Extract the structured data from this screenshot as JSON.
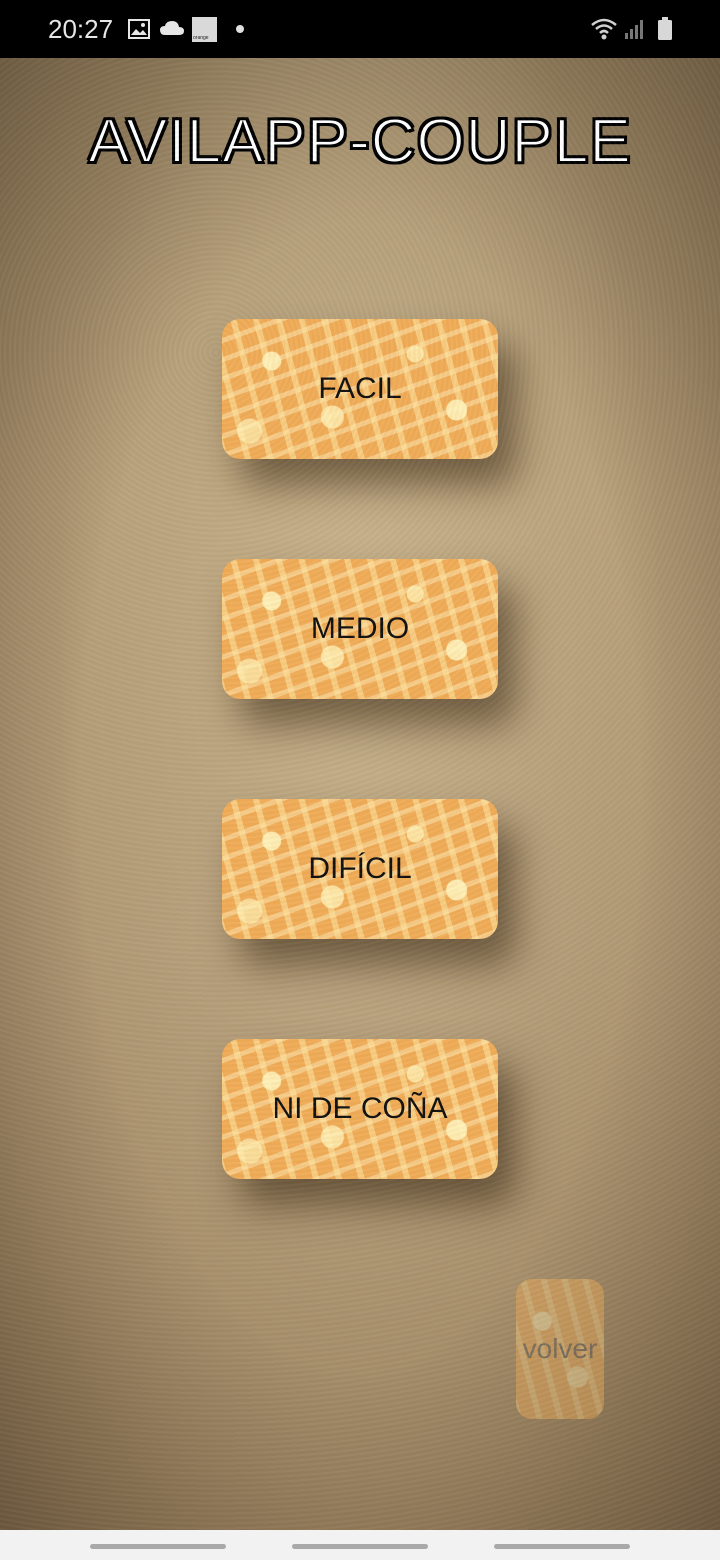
{
  "status_bar": {
    "time": "20:27",
    "carrier_badge": "orange",
    "icons": [
      "gallery-icon",
      "cloud-icon",
      "orange-icon",
      "dot-icon",
      "wifi-icon",
      "signal-icon",
      "battery-icon"
    ]
  },
  "app": {
    "title": "AVILAPP-COUPLE"
  },
  "levels": {
    "easy": "FACIL",
    "medium": "MEDIO",
    "hard": "DIFÍCIL",
    "impossible": "NI DE COÑA"
  },
  "back": {
    "label": "volver"
  },
  "colors": {
    "button_orange": "#f0ac58",
    "background_parchment": "#b09874"
  }
}
